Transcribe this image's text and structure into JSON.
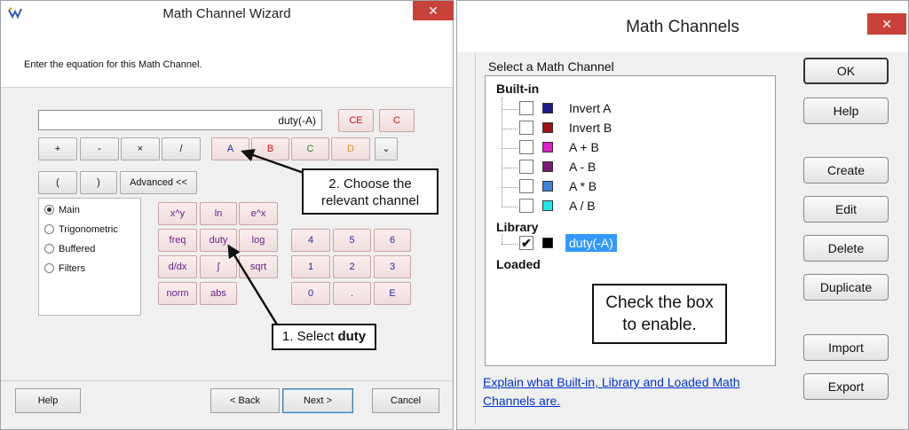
{
  "left_window": {
    "title": "Math Channel Wizard",
    "close_glyph": "✕",
    "prompt": "Enter the equation for this Math Channel.",
    "equation_value": "duty(-A)",
    "clear_buttons": [
      "CE",
      "C"
    ],
    "operators": [
      "+",
      "-",
      "×",
      "/"
    ],
    "channels": [
      "A",
      "B",
      "C",
      "D"
    ],
    "channel_dropdown_glyph": "⌄",
    "parens": [
      "(",
      ")"
    ],
    "advanced_label": "Advanced <<",
    "modes": [
      "Main",
      "Trigonometric",
      "Buffered",
      "Filters"
    ],
    "selected_mode": "Main",
    "functions": [
      "x^y",
      "ln",
      "e^x",
      "freq",
      "duty",
      "log",
      "d/dx",
      "∫",
      "sqrt",
      "norm",
      "abs"
    ],
    "numpad": [
      "4",
      "5",
      "6",
      "1",
      "2",
      "3",
      "0",
      ".",
      "E"
    ],
    "footer": {
      "help": "Help",
      "back": "< Back",
      "next": "Next >",
      "cancel": "Cancel"
    },
    "callout_select_prefix": "1. Select ",
    "callout_select_bold": "duty",
    "callout_channel_line1": "2. Choose the",
    "callout_channel_line2": "relevant channel"
  },
  "right_window": {
    "title": "Math Channels",
    "close_glyph": "✕",
    "group_label": "Select a Math Channel",
    "sections": {
      "builtin": "Built-in",
      "library": "Library",
      "loaded": "Loaded"
    },
    "builtin_items": [
      {
        "label": "Invert A",
        "color": "#1c1c8c",
        "checked": false
      },
      {
        "label": "Invert B",
        "color": "#a01010",
        "checked": false
      },
      {
        "label": "A + B",
        "color": "#e020c8",
        "checked": false
      },
      {
        "label": "A - B",
        "color": "#7a1a7a",
        "checked": false
      },
      {
        "label": "A * B",
        "color": "#3a82e0",
        "checked": false
      },
      {
        "label": "A / B",
        "color": "#20e8e8",
        "checked": false
      }
    ],
    "library_items": [
      {
        "label": "duty(-A)",
        "color": "#000000",
        "checked": true,
        "selected": true
      }
    ],
    "buttons": [
      "OK",
      "Help",
      "Create",
      "Edit",
      "Delete",
      "Duplicate",
      "Import",
      "Export"
    ],
    "link_text": "Explain what Built-in, Library and Loaded Math Channels are.",
    "callout_line1": "Check the box",
    "callout_line2": "to enable."
  }
}
